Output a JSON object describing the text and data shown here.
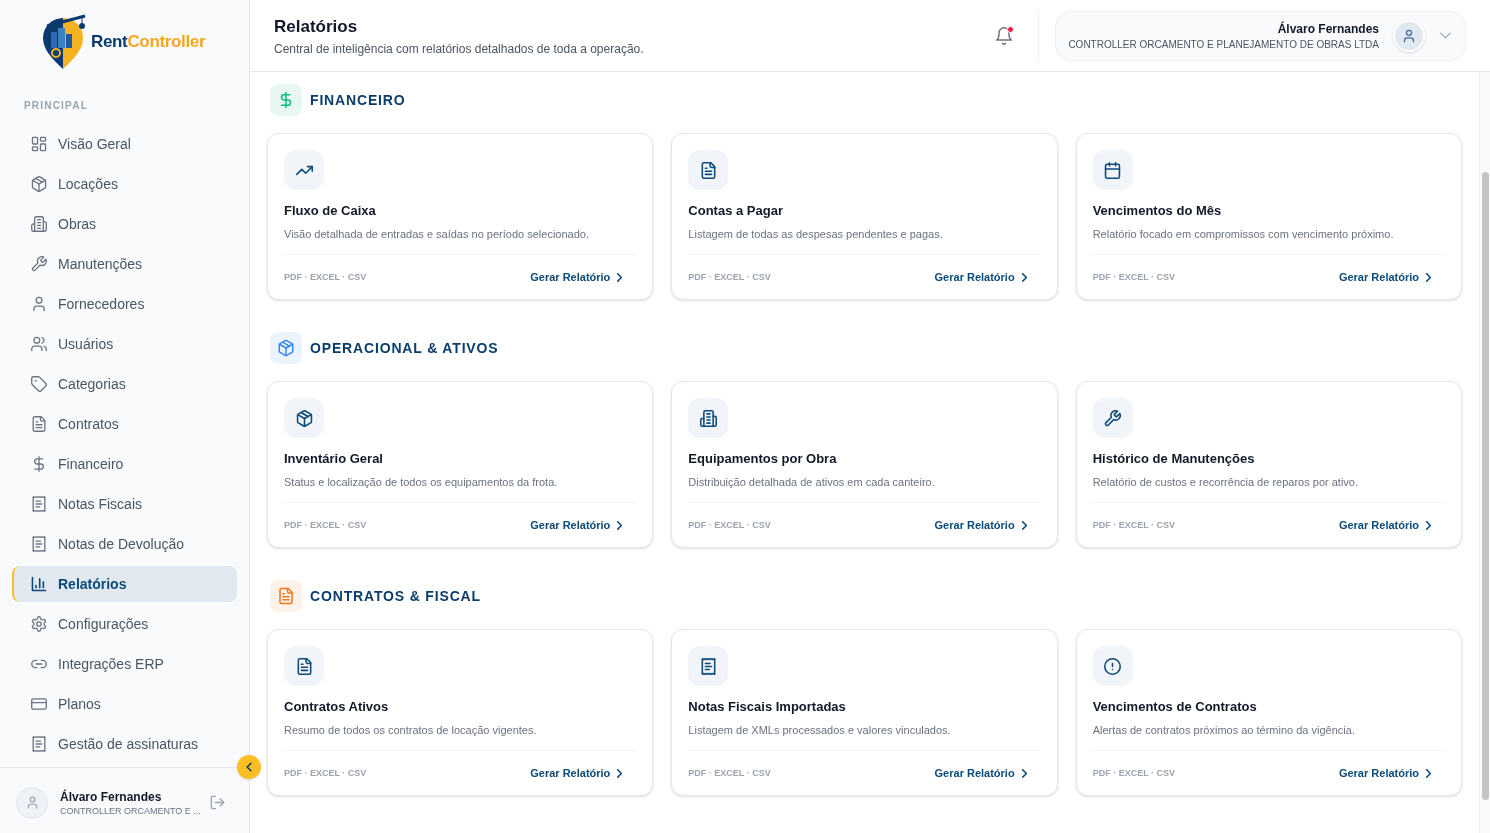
{
  "sidebar": {
    "brand": {
      "first": "Rent",
      "second": "Controller"
    },
    "section_label": "PRINCIPAL",
    "items": [
      {
        "label": "Visão Geral",
        "selected": false
      },
      {
        "label": "Locações",
        "selected": false
      },
      {
        "label": "Obras",
        "selected": false
      },
      {
        "label": "Manutenções",
        "selected": false
      },
      {
        "label": "Fornecedores",
        "selected": false
      },
      {
        "label": "Usuários",
        "selected": false
      },
      {
        "label": "Categorias",
        "selected": false
      },
      {
        "label": "Contratos",
        "selected": false
      },
      {
        "label": "Financeiro",
        "selected": false
      },
      {
        "label": "Notas Fiscais",
        "selected": false
      },
      {
        "label": "Notas de Devolução",
        "selected": false
      },
      {
        "label": "Relatórios",
        "selected": true
      },
      {
        "label": "Configurações",
        "selected": false
      },
      {
        "label": "Integrações ERP",
        "selected": false
      },
      {
        "label": "Planos",
        "selected": false
      },
      {
        "label": "Gestão de assinaturas",
        "selected": false
      }
    ],
    "user": {
      "name": "Álvaro Fernandes",
      "company": "CONTROLLER ORCAMENTO E ..."
    }
  },
  "header": {
    "title": "Relatórios",
    "subtitle": "Central de inteligência com relatórios detalhados de toda a operação.",
    "notifications": {
      "unread": true
    },
    "user": {
      "name": "Álvaro Fernandes",
      "company": "CONTROLLER ORCAMENTO E PLANEJAMENTO DE OBRAS LTDA"
    }
  },
  "sections": [
    {
      "title": "FINANCEIRO",
      "color": "#e7f8f2",
      "cards": [
        {
          "title": "Fluxo de Caixa",
          "description": "Visão detalhada de entradas e saídas no período selecionado.",
          "formats": "PDF · EXCEL · CSV",
          "action": "Gerar Relatório"
        },
        {
          "title": "Contas a Pagar",
          "description": "Listagem de todas as despesas pendentes e pagas.",
          "formats": "PDF · EXCEL · CSV",
          "action": "Gerar Relatório"
        },
        {
          "title": "Vencimentos do Mês",
          "description": "Relatório focado em compromissos com vencimento próximo.",
          "formats": "PDF · EXCEL · CSV",
          "action": "Gerar Relatório"
        }
      ]
    },
    {
      "title": "OPERACIONAL & ATIVOS",
      "color": "#ebf3fe",
      "cards": [
        {
          "title": "Inventário Geral",
          "description": "Status e localização de todos os equipamentos da frota.",
          "formats": "PDF · EXCEL · CSV",
          "action": "Gerar Relatório"
        },
        {
          "title": "Equipamentos por Obra",
          "description": "Distribuição detalhada de ativos em cada canteiro.",
          "formats": "PDF · EXCEL · CSV",
          "action": "Gerar Relatório"
        },
        {
          "title": "Histórico de Manutenções",
          "description": "Relatório de custos e recorrência de reparos por ativo.",
          "formats": "PDF · EXCEL · CSV",
          "action": "Gerar Relatório"
        }
      ]
    },
    {
      "title": "CONTRATOS & FISCAL",
      "color": "#fef1e8",
      "cards": [
        {
          "title": "Contratos Ativos",
          "description": "Resumo de todos os contratos de locação vigentes.",
          "formats": "PDF · EXCEL · CSV",
          "action": "Gerar Relatório"
        },
        {
          "title": "Notas Fiscais Importadas",
          "description": "Listagem de XMLs processados e valores vinculados.",
          "formats": "PDF · EXCEL · CSV",
          "action": "Gerar Relatório"
        },
        {
          "title": "Vencimentos de Contratos",
          "description": "Alertas de contratos próximos ao término da vigência.",
          "formats": "PDF · EXCEL · CSV",
          "action": "Gerar Relatório"
        }
      ]
    }
  ]
}
